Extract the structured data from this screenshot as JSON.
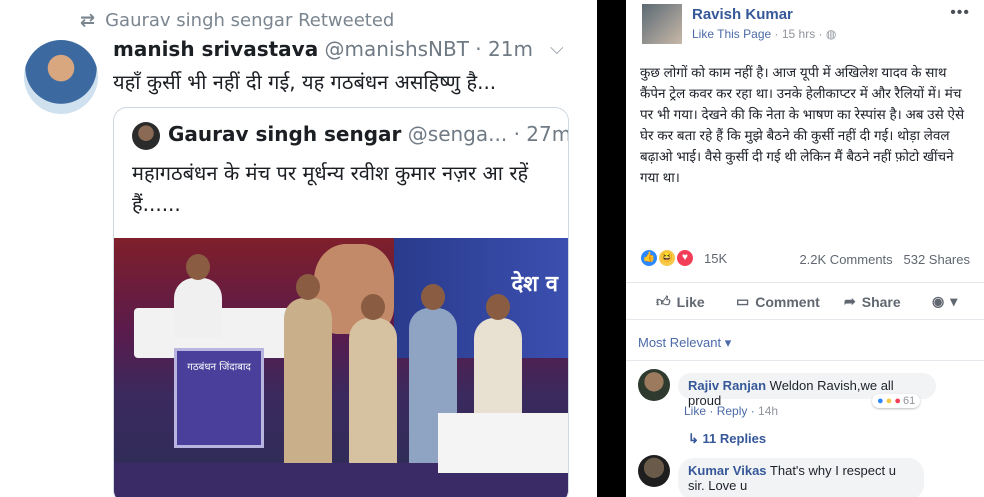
{
  "tweet": {
    "retweet_text": "Gaurav singh sengar Retweeted",
    "author_name": "manish srivastava",
    "author_handle": "@manishsNBT",
    "time": "· 21m",
    "text": "यहाँ कुर्सी भी नहीं दी गई, यह गठबंधन असहिष्णु है...",
    "quoted": {
      "author_name": "Gaurav singh sengar",
      "author_handle": "@senga...",
      "time": "· 27m",
      "text": "महागठबंधन के मंच पर मूर्धन्य रवीश कुमार नज़र आ रहें हैं......",
      "photo_sign": "देश व",
      "photo_board": "गठबंधन जिंदाबाद"
    }
  },
  "fb": {
    "page_name": "Ravish Kumar",
    "like_page": "Like This Page",
    "time": "· 15 hrs ·",
    "post_text": "कुछ लोगों को काम नहीं है। आज यूपी में अखिलेश यादव के साथ कैंपेन ट्रेल कवर कर रहा था। उनके हेलीकाप्टर में और रैलियों में। मंच पर भी गया। देखने की कि नेता के भाषण का रेस्पांस है। अब उसे ऐसे घेर कर बता रहे हैं कि मुझे बैठने की कुर्सी नहीं दी गई। थोड़ा लेवल बढ़ाओ भाई। वैसे कुर्सी दी गई थी लेकिन मैं बैठने नहीं फ़ोटो खींचने गया था।",
    "reactions_count": "15K",
    "comments_count": "2.2K Comments",
    "shares_count": "532 Shares",
    "actions": {
      "like": "Like",
      "comment": "Comment",
      "share": "Share"
    },
    "sort_label": "Most Relevant ▾",
    "comments": [
      {
        "name": "Rajiv Ranjan",
        "text": "Weldon Ravish,we all proud",
        "like": "Like",
        "reply": "Reply",
        "time": "14h",
        "reactions": "61",
        "replies": "11 Replies"
      },
      {
        "name": "Kumar Vikas",
        "text": "That's why I respect u sir. Love u"
      }
    ]
  }
}
